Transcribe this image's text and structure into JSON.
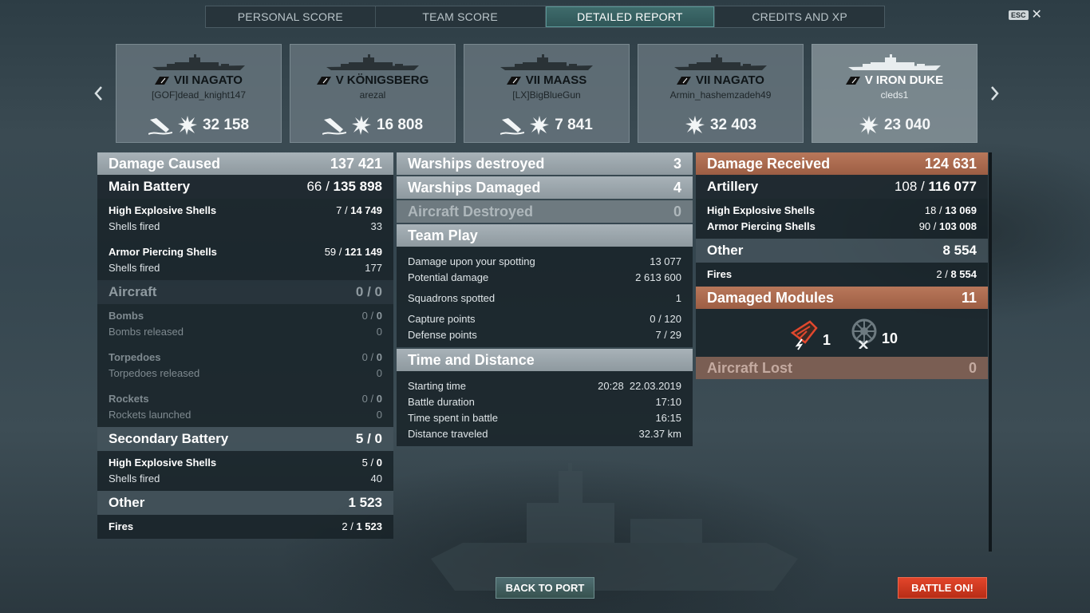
{
  "tabs": [
    {
      "label": "PERSONAL SCORE"
    },
    {
      "label": "TEAM SCORE"
    },
    {
      "label": "DETAILED REPORT"
    },
    {
      "label": "CREDITS AND XP"
    }
  ],
  "esc": {
    "key": "ESC",
    "close": "✕"
  },
  "ships": [
    {
      "tier": "VII",
      "name": "NAGATO",
      "player": "[GOF]dead_knight147",
      "damage": "32 158",
      "destroyed": true,
      "class_icon": "battleship-icon"
    },
    {
      "tier": "V",
      "name": "KÖNIGSBERG",
      "player": "arezal",
      "damage": "16 808",
      "destroyed": true,
      "class_icon": "cruiser-icon"
    },
    {
      "tier": "VII",
      "name": "MAASS",
      "player": "[LX]BigBlueGun",
      "damage": "7 841",
      "destroyed": true,
      "class_icon": "destroyer-icon"
    },
    {
      "tier": "VII",
      "name": "NAGATO",
      "player": "Armin_hashemzadeh49",
      "damage": "32 403",
      "destroyed": false,
      "class_icon": "battleship-icon"
    },
    {
      "tier": "V",
      "name": "IRON DUKE",
      "player": "cleds1",
      "damage": "23 040",
      "destroyed": false,
      "class_icon": "battleship-icon"
    }
  ],
  "left": {
    "damage_caused": {
      "label": "Damage Caused",
      "value": "137 421"
    },
    "main_battery": {
      "label": "Main Battery",
      "hits": "66 /",
      "total": "135 898"
    },
    "he": {
      "label": "High Explosive Shells",
      "hits": "7 /",
      "total": "14 749"
    },
    "he_fired": {
      "label": "Shells fired",
      "value": "33"
    },
    "ap": {
      "label": "Armor Piercing Shells",
      "hits": "59 /",
      "total": "121 149"
    },
    "ap_fired": {
      "label": "Shells fired",
      "value": "177"
    },
    "aircraft": {
      "label": "Aircraft",
      "value": "0 / 0"
    },
    "bombs": {
      "label": "Bombs",
      "hits": "0 /",
      "total": "0"
    },
    "bombs_rel": {
      "label": "Bombs released",
      "value": "0"
    },
    "torps": {
      "label": "Torpedoes",
      "hits": "0 /",
      "total": "0"
    },
    "torps_rel": {
      "label": "Torpedoes released",
      "value": "0"
    },
    "rockets": {
      "label": "Rockets",
      "hits": "0 /",
      "total": "0"
    },
    "rockets_l": {
      "label": "Rockets launched",
      "value": "0"
    },
    "secondary": {
      "label": "Secondary Battery",
      "value": "5 / 0"
    },
    "sec_he": {
      "label": "High Explosive Shells",
      "hits": "5 /",
      "total": "0"
    },
    "sec_fired": {
      "label": "Shells fired",
      "value": "40"
    },
    "other": {
      "label": "Other",
      "value": "1 523"
    },
    "fires": {
      "label": "Fires",
      "hits": "2 /",
      "total": "1 523"
    }
  },
  "mid": {
    "destroyed": {
      "label": "Warships destroyed",
      "value": "3"
    },
    "damaged": {
      "label": "Warships Damaged",
      "value": "4"
    },
    "aircraft_destroyed": {
      "label": "Aircraft Destroyed",
      "value": "0"
    },
    "team_play": {
      "label": "Team Play"
    },
    "spotting": {
      "label": "Damage upon your spotting",
      "value": "13 077"
    },
    "potential": {
      "label": "Potential damage",
      "value": "2 613 600"
    },
    "squadrons": {
      "label": "Squadrons spotted",
      "value": "1"
    },
    "capture": {
      "label": "Capture points",
      "value": "0 / 120"
    },
    "defense": {
      "label": "Defense points",
      "value": "7 / 29"
    },
    "time_distance": {
      "label": "Time and Distance"
    },
    "start": {
      "label": "Starting time",
      "value": "20:28  22.03.2019"
    },
    "duration": {
      "label": "Battle duration",
      "value": "17:10"
    },
    "time_spent": {
      "label": "Time spent in battle",
      "value": "16:15"
    },
    "distance": {
      "label": "Distance traveled",
      "value": "32.37 km"
    }
  },
  "right": {
    "damage_received": {
      "label": "Damage Received",
      "value": "124 631"
    },
    "artillery": {
      "label": "Artillery",
      "hits": "108 /",
      "total": "116 077"
    },
    "he": {
      "label": "High Explosive Shells",
      "hits": "18 /",
      "total": "13 069"
    },
    "ap": {
      "label": "Armor Piercing Shells",
      "hits": "90 /",
      "total": "103 008"
    },
    "other": {
      "label": "Other",
      "value": "8 554"
    },
    "fires": {
      "label": "Fires",
      "hits": "2 /",
      "total": "8 554"
    },
    "modules": {
      "label": "Damaged Modules",
      "value": "11"
    },
    "module_items": [
      {
        "icon": "engine-damaged-icon",
        "count": "1"
      },
      {
        "icon": "steering-gear-icon",
        "count": "10"
      }
    ],
    "aircraft_lost": {
      "label": "Aircraft Lost",
      "value": "0"
    }
  },
  "buttons": {
    "back": "BACK TO PORT",
    "battle": "BATTLE ON!"
  },
  "colors": {
    "accent_orange": "#a9684c",
    "battle_red": "#d03a20",
    "tab_active": "#3f6c6c"
  }
}
